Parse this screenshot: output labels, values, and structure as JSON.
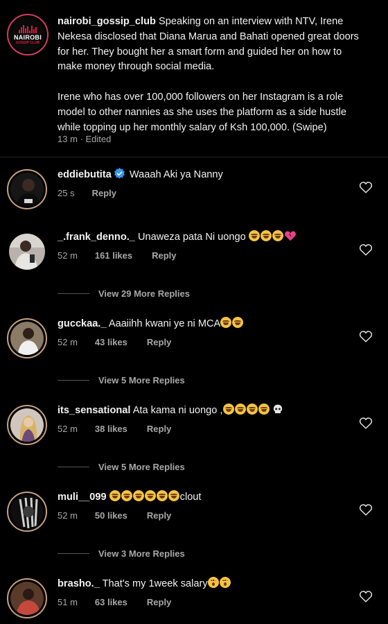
{
  "caption": {
    "username": "nairobi_gossip_club",
    "paragraph1": "Speaking on an interview with NTV, Irene Nekesa disclosed that Diana Marua and Bahati opened great doors for her. They bought her a smart form and guided her on how to make money through social media.",
    "paragraph2": "Irene who has over 100,000 followers on her Instagram is a role model to other nannies as she uses the platform as a side hustle while topping up her monthly salary of Ksh 100,000. (Swipe)",
    "meta": "13 m · Edited",
    "logo_name": "NAIROBI",
    "logo_sub": "GOSSIP CLUB"
  },
  "comments": [
    {
      "username": "eddiebutita",
      "verified": true,
      "text": "Waaah Aki ya Nanny",
      "time": "25 s",
      "likes": "",
      "reply_label": "Reply",
      "view_replies": ""
    },
    {
      "username": "_.frank_denno._",
      "verified": false,
      "text": "Unaweza pata Ni uongo",
      "time": "52 m",
      "likes": "161 likes",
      "reply_label": "Reply",
      "view_replies": "View 29 More Replies"
    },
    {
      "username": "gucckaa._",
      "verified": false,
      "text": "Aaaiihh kwani ye ni MCA",
      "time": "52 m",
      "likes": "43 likes",
      "reply_label": "Reply",
      "view_replies": "View 5 More Replies"
    },
    {
      "username": "its_sensational",
      "verified": false,
      "text": "Ata kama ni uongo ,",
      "time": "52 m",
      "likes": "38 likes",
      "reply_label": "Reply",
      "view_replies": "View 5 More Replies"
    },
    {
      "username": "muli__099",
      "verified": false,
      "text": "clout",
      "time": "52 m",
      "likes": "50 likes",
      "reply_label": "Reply",
      "view_replies": "View 3 More Replies"
    },
    {
      "username": "brasho._",
      "verified": false,
      "text": "That's my 1week salary",
      "time": "51 m",
      "likes": "63 likes",
      "reply_label": "Reply",
      "view_replies": ""
    }
  ],
  "colors": {
    "background": "#000000",
    "meta": "#a8a8a8",
    "verified": "#3897f0",
    "story_ring": "#c8a27e"
  },
  "icons": {
    "like": "heart-outline-icon",
    "verified": "verified-badge-icon"
  }
}
